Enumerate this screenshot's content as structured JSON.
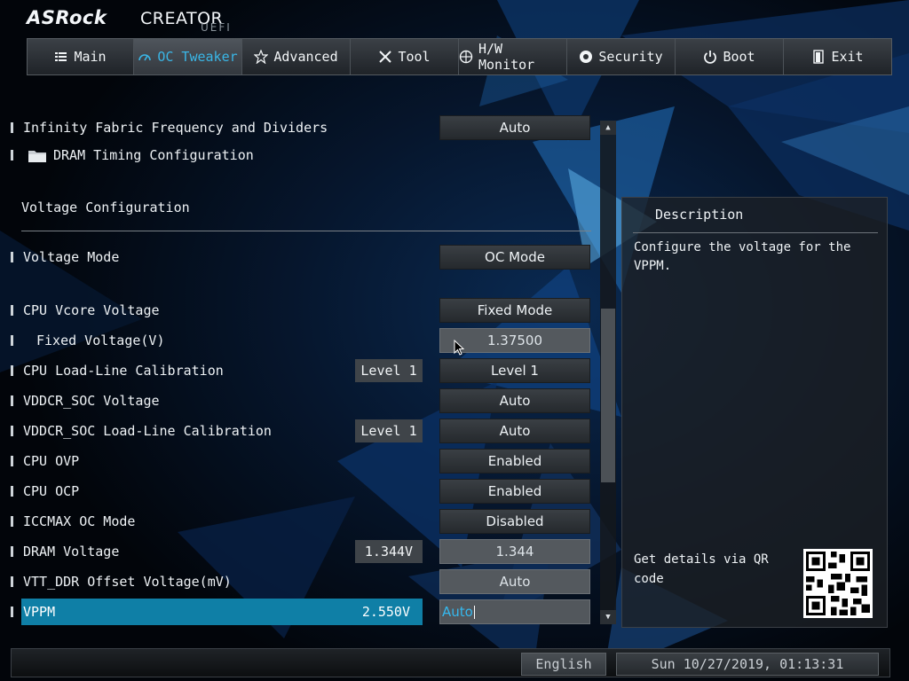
{
  "header": {
    "brand": "ASRock",
    "product": "CREATOR",
    "firmware": "UEFI"
  },
  "tabs": [
    {
      "label": "Main",
      "icon": "list-icon",
      "active": false
    },
    {
      "label": "OC Tweaker",
      "icon": "speedometer-icon",
      "active": true
    },
    {
      "label": "Advanced",
      "icon": "star-icon",
      "active": false
    },
    {
      "label": "Tool",
      "icon": "tools-icon",
      "active": false
    },
    {
      "label": "H/W Monitor",
      "icon": "monitor-icon",
      "active": false
    },
    {
      "label": "Security",
      "icon": "shield-icon",
      "active": false
    },
    {
      "label": "Boot",
      "icon": "power-icon",
      "active": false
    },
    {
      "label": "Exit",
      "icon": "exit-icon",
      "active": false
    }
  ],
  "settings": {
    "infinity_fabric": {
      "label": "Infinity Fabric Frequency and Dividers",
      "value": "Auto"
    },
    "dram_timing": {
      "label": "DRAM Timing Configuration",
      "icon": "folder-icon"
    },
    "section_title": "Voltage Configuration",
    "voltage_mode": {
      "label": "Voltage Mode",
      "value": "OC Mode"
    },
    "cpu_vcore": {
      "label": "CPU Vcore Voltage",
      "value": "Fixed Mode"
    },
    "fixed_voltage": {
      "label": "Fixed Voltage(V)",
      "value": "1.37500"
    },
    "cpu_llc": {
      "label": "CPU Load-Line Calibration",
      "current": "Level 1",
      "value": "Level 1"
    },
    "vddcr_soc": {
      "label": "VDDCR_SOC Voltage",
      "value": "Auto"
    },
    "vddcr_soc_llc": {
      "label": "VDDCR_SOC Load-Line Calibration",
      "current": "Level 1",
      "value": "Auto"
    },
    "cpu_ovp": {
      "label": "CPU OVP",
      "value": "Enabled"
    },
    "cpu_ocp": {
      "label": "CPU OCP",
      "value": "Enabled"
    },
    "iccmax": {
      "label": "ICCMAX OC Mode",
      "value": "Disabled"
    },
    "dram_voltage": {
      "label": "DRAM Voltage",
      "current": "1.344V",
      "value": "1.344"
    },
    "vtt_ddr": {
      "label": "VTT_DDR Offset Voltage(mV)",
      "value": "Auto"
    },
    "vppm": {
      "label": "VPPM",
      "current": "2.550V",
      "value": "Auto"
    }
  },
  "description": {
    "title": "Description",
    "text": "Configure the voltage for the VPPM.",
    "qr_text": "Get details via QR code"
  },
  "footer": {
    "language": "English",
    "datetime": "Sun 10/27/2019, 01:13:31"
  },
  "colors": {
    "accent": "#3ab6e6",
    "selection": "#0f7fa6"
  }
}
